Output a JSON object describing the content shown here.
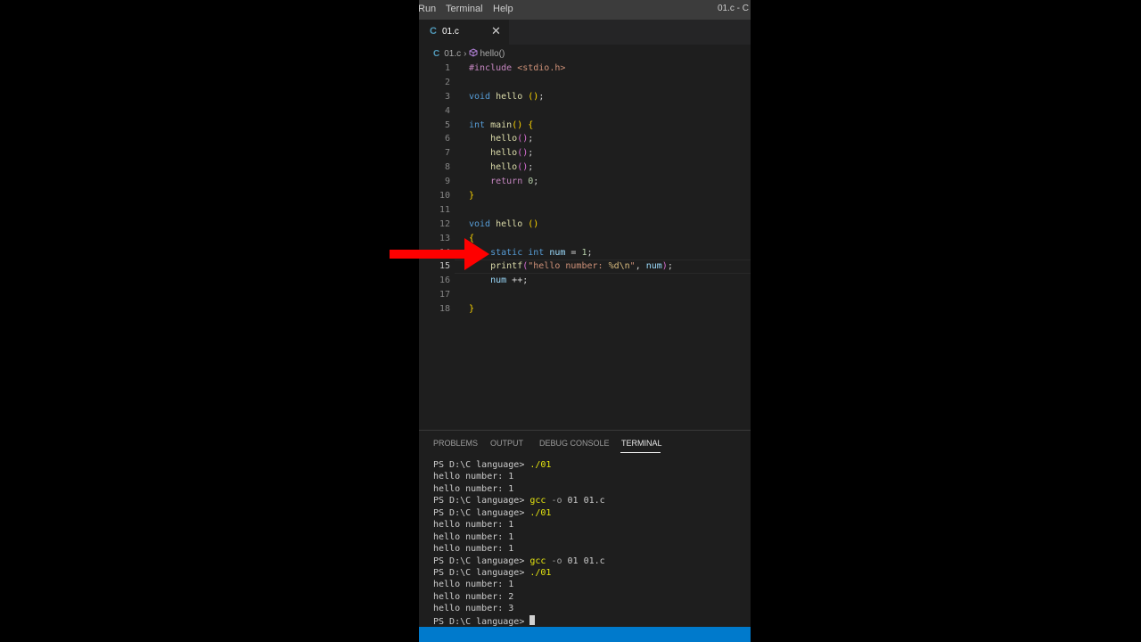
{
  "menubar": {
    "items": [
      "Run",
      "Terminal",
      "Help"
    ],
    "window_title": "01.c - C"
  },
  "tab": {
    "icon": "c-language-icon",
    "icon_text": "C",
    "label": "01.c",
    "close": "✕"
  },
  "breadcrumb": {
    "icon_text": "C",
    "file": "01.c",
    "separator": "›",
    "method_icon": "method-cube-icon",
    "symbol": "hello()"
  },
  "editor": {
    "line_numbers": [
      "1",
      "2",
      "3",
      "4",
      "5",
      "6",
      "7",
      "8",
      "9",
      "10",
      "11",
      "12",
      "13",
      "14",
      "15",
      "16",
      "17",
      "18"
    ],
    "code": {
      "l1_pre": "#include",
      "l1_inc": " <stdio.h>",
      "l3_kw": "void",
      "l3_fn": "hello",
      "l3_p1": "(",
      "l3_p2": ")",
      "l3_end": ";",
      "l5_kw": "int",
      "l5_fn": "main",
      "l5_p1": "(",
      "l5_p2": ")",
      "l5_b": "{",
      "l6_fn": "hello",
      "l6_p": "()",
      "l6_e": ";",
      "l7_fn": "hello",
      "l7_p": "()",
      "l7_e": ";",
      "l8_fn": "hello",
      "l8_p": "()",
      "l8_e": ";",
      "l9_kw": "return",
      "l9_num": "0",
      "l9_e": ";",
      "l10_b": "}",
      "l12_kw": "void",
      "l12_fn": "hello",
      "l12_p": "()",
      "l13_b": "{",
      "l14_kw1": "static",
      "l14_kw2": "int",
      "l14_var": "num",
      "l14_eq": " = ",
      "l14_num": "1",
      "l14_e": ";",
      "l15_fn": "printf",
      "l15_p1": "(",
      "l15_str1": "\"hello number: ",
      "l15_esc": "%d\\n",
      "l15_str2": "\"",
      "l15_comma": ", ",
      "l15_var": "num",
      "l15_p2": ")",
      "l15_e": ";",
      "l16_var": "num",
      "l16_op": " ++;",
      "l18_b": "}"
    }
  },
  "panel": {
    "tabs": [
      "PROBLEMS",
      "OUTPUT",
      "DEBUG CONSOLE",
      "TERMINAL"
    ],
    "active_tab": "TERMINAL",
    "prompt": "PS D:\\C language> ",
    "terminal": {
      "l1_cmd": "./01",
      "l2": "hello number: 1",
      "l3": "hello number: 1",
      "l4_cmd": "gcc",
      "l4_flag": " -o ",
      "l4_rest": "01 01.c",
      "l5_cmd": "./01",
      "l6": "hello number: 1",
      "l7": "hello number: 1",
      "l8": "hello number: 1",
      "l9_cmd": "gcc",
      "l9_flag": " -o ",
      "l9_rest": "01 01.c",
      "l10_cmd": "./01",
      "l11": "hello number: 1",
      "l12": "hello number: 2",
      "l13": "hello number: 3"
    }
  },
  "overlay": {
    "arrow_color": "#ff0000",
    "arrow_icon": "red-arrow-icon"
  }
}
